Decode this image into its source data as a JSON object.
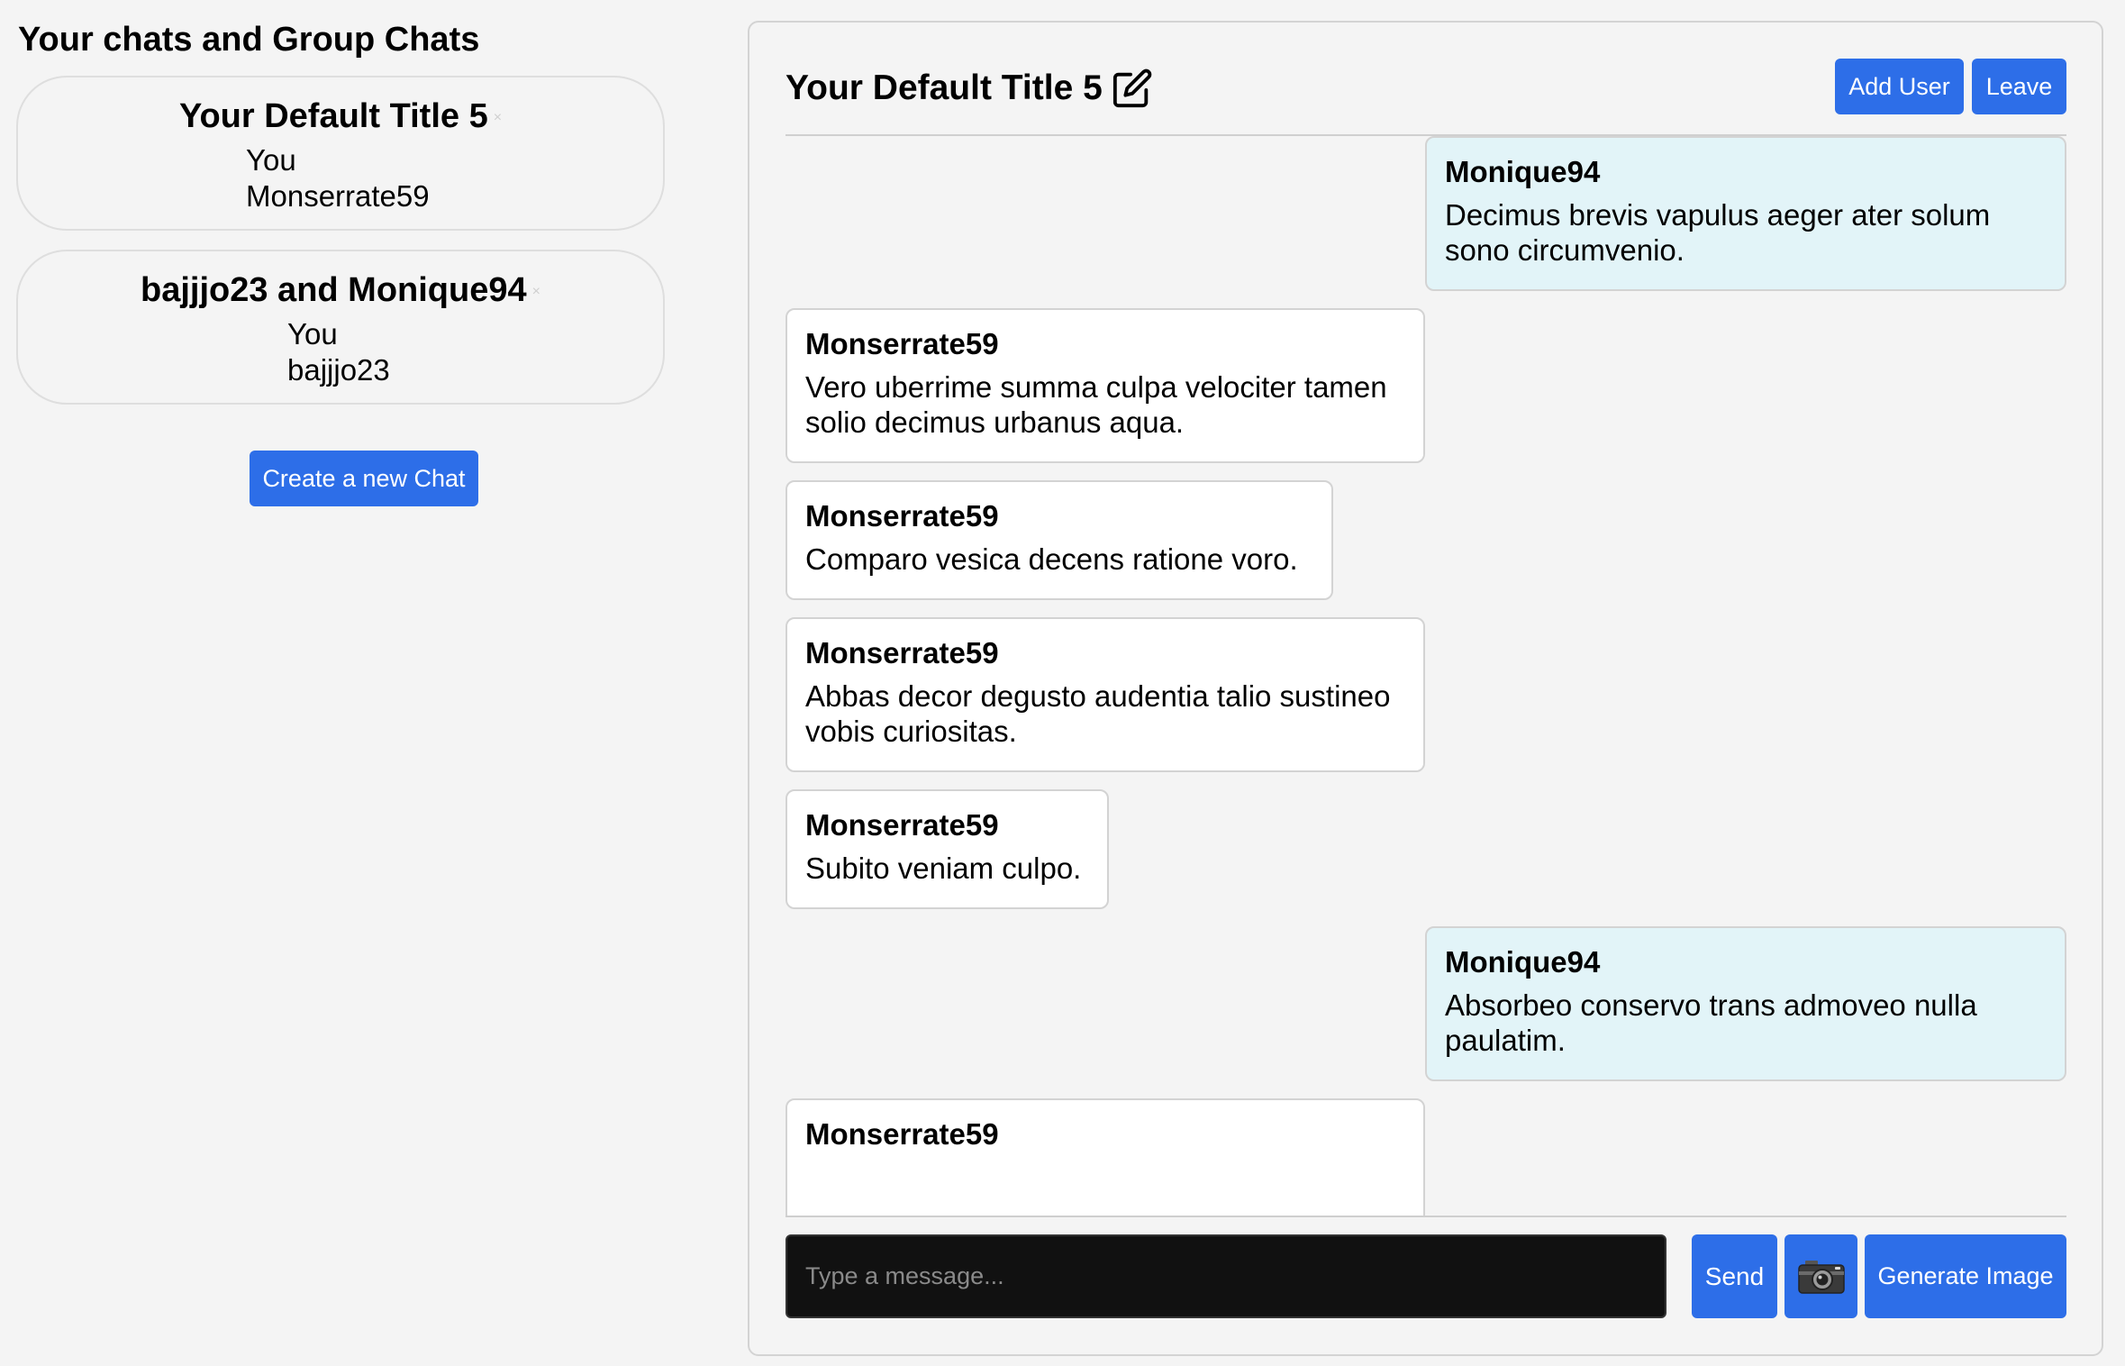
{
  "sidebar": {
    "title": "Your chats and Group Chats",
    "chats": [
      {
        "title": "Your Default Title 5",
        "close": "×",
        "members": [
          "You",
          "Monserrate59"
        ]
      },
      {
        "title": "bajjjo23 and Monique94",
        "close": "×",
        "members": [
          "You",
          "bajjjo23"
        ]
      }
    ],
    "create_label": "Create a new Chat"
  },
  "chat": {
    "title": "Your Default Title 5",
    "add_user_label": "Add User",
    "leave_label": "Leave",
    "messages": [
      {
        "sender": "Monique94",
        "text": "Decimus brevis vapulus aeger ater solum sono circumvenio."
      },
      {
        "sender": "Monserrate59",
        "text": "Vero uberrime summa culpa velociter tamen solio decimus urbanus aqua."
      },
      {
        "sender": "Monserrate59",
        "text": "Comparo vesica decens ratione voro."
      },
      {
        "sender": "Monserrate59",
        "text": "Abbas decor degusto audentia talio sustineo vobis curiositas."
      },
      {
        "sender": "Monserrate59",
        "text": "Subito veniam culpo."
      },
      {
        "sender": "Monique94",
        "text": "Absorbeo conservo trans admoveo nulla paulatim."
      },
      {
        "sender": "Monserrate59",
        "text": ""
      }
    ],
    "input_placeholder": "Type a message...",
    "send_label": "Send",
    "camera_icon": "camera-icon",
    "generate_label": "Generate Image"
  },
  "colors": {
    "accent": "#2d6ee8",
    "incoming_bubble": "#e2f4f8",
    "outgoing_bubble": "#ffffff",
    "background": "#f4f4f4",
    "input_bg": "#111111"
  }
}
